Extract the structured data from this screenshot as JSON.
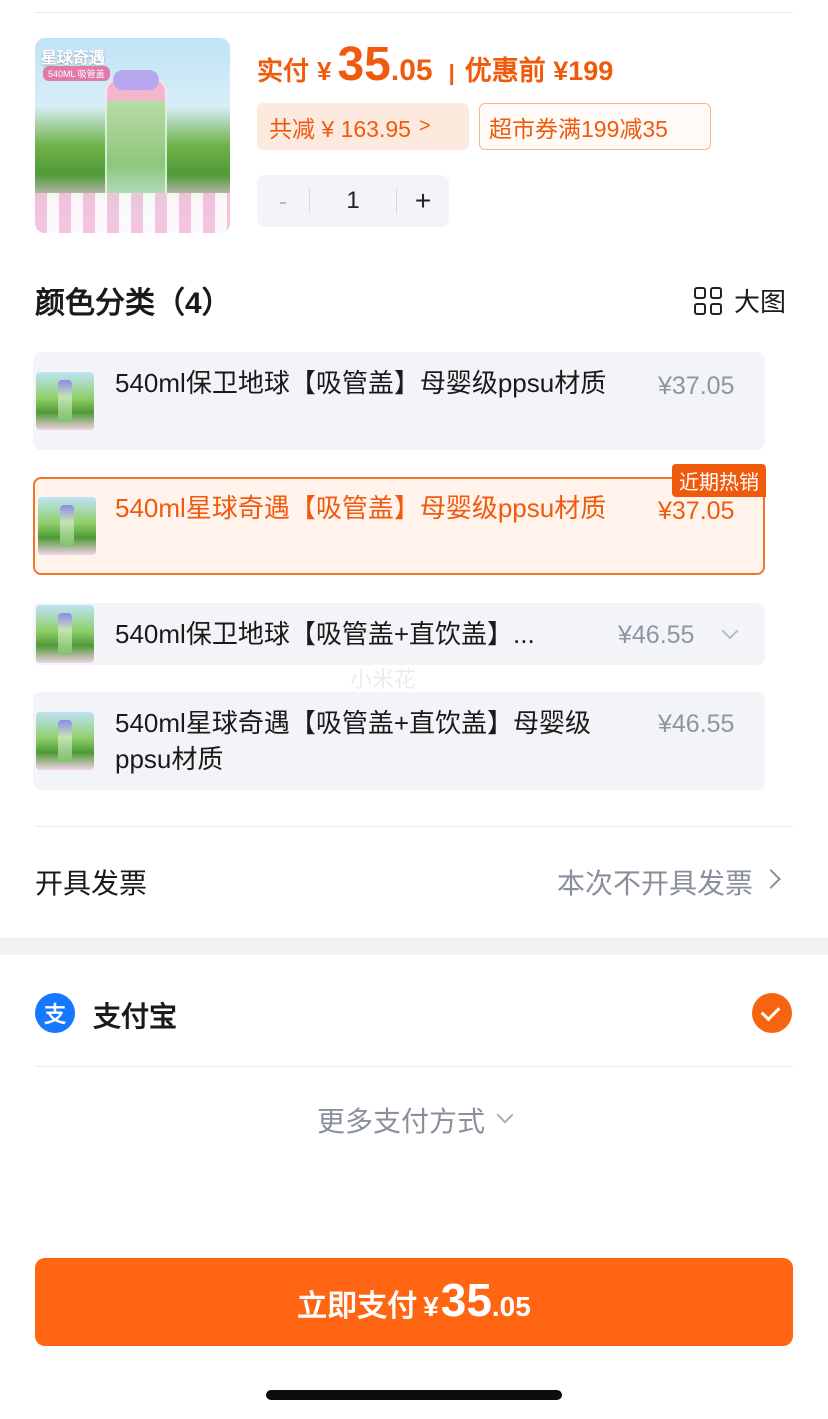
{
  "product": {
    "image_badge": "星球奇遇",
    "image_badge_sub": "540ML 吸管盖",
    "pay_label": "实付",
    "currency": "¥",
    "price_int": "35",
    "price_dec": ".05",
    "separator": "|",
    "orig_label": "优惠前 ¥199",
    "reduce_chip": "共减 ¥ 163.95",
    "coupon_chip": "超市券满199减35",
    "quantity": "1",
    "minus_symbol": "-",
    "plus_symbol": "+"
  },
  "color_section": {
    "title": "颜色分类（4）",
    "big_view_label": "大图",
    "options": [
      {
        "label": "540ml保卫地球【吸管盖】母婴级ppsu材质",
        "price": "¥37.05",
        "selected": false
      },
      {
        "label": "540ml星球奇遇【吸管盖】母婴级ppsu材质",
        "price": "¥37.05",
        "selected": true,
        "tag": "近期热销"
      },
      {
        "label": "540ml保卫地球【吸管盖+直饮盖】...",
        "price": "¥46.55",
        "selected": false
      },
      {
        "label": "540ml星球奇遇【吸管盖+直饮盖】母婴级ppsu材质",
        "price": "¥46.55",
        "selected": false
      }
    ]
  },
  "watermark": "小米花",
  "invoice": {
    "label": "开具发票",
    "value": "本次不开具发票"
  },
  "payment": {
    "alipay_icon_glyph": "支",
    "alipay_label": "支付宝",
    "more_label": "更多支付方式"
  },
  "pay_button": {
    "label": "立即支付",
    "currency": "¥",
    "price_int": "35",
    "price_dec": ".05"
  },
  "colors": {
    "accent": "#f05a0c",
    "button": "#ff6512",
    "alipay": "#1677ff"
  }
}
